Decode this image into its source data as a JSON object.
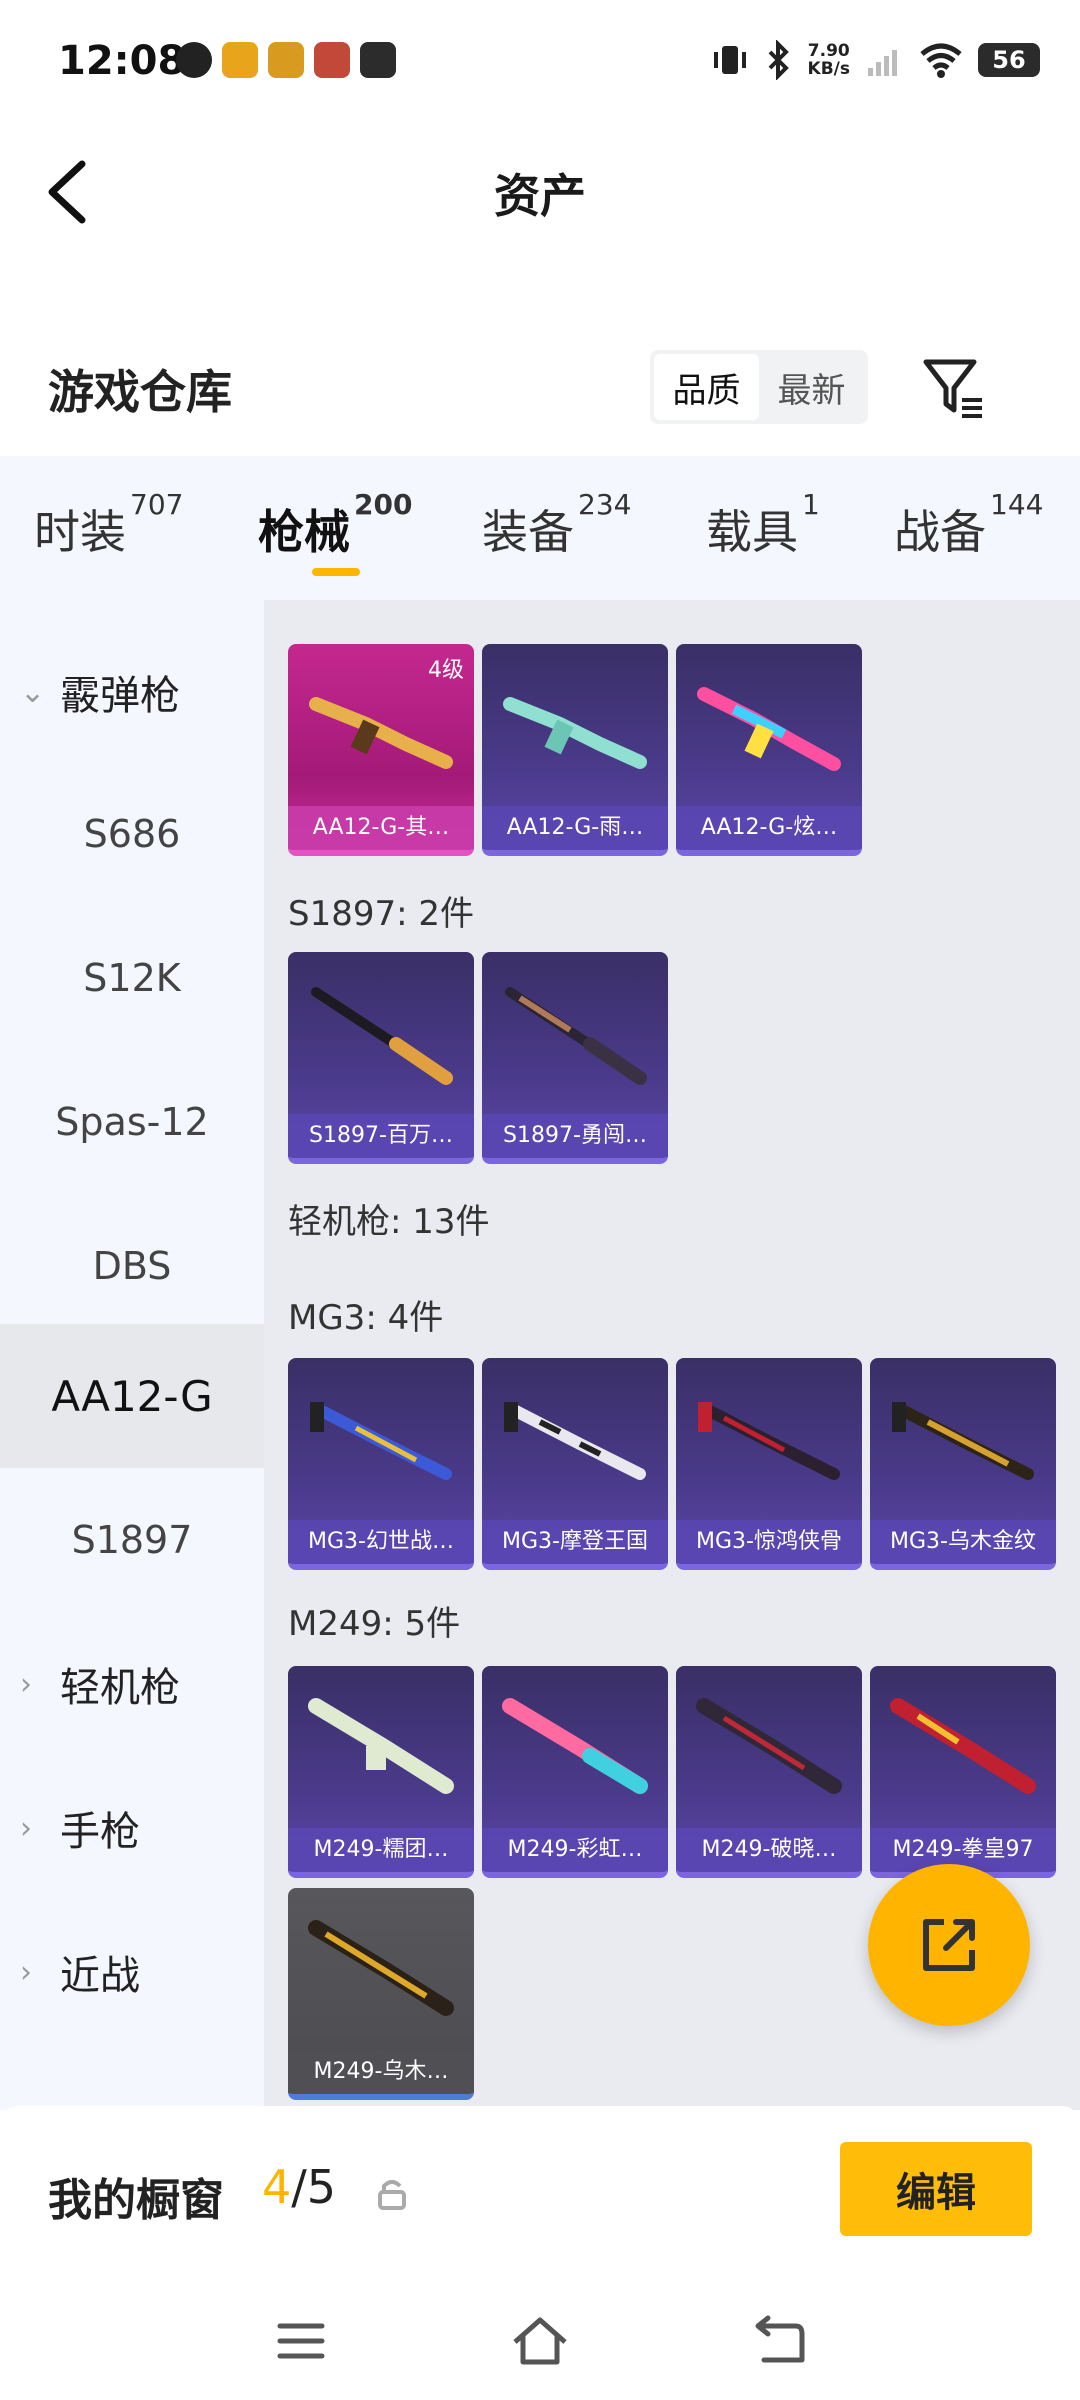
{
  "status": {
    "time": "12:08",
    "net_speed_value": "7.90",
    "net_speed_unit": "KB/s",
    "battery": "56"
  },
  "header": {
    "title": "资产"
  },
  "warehouse": {
    "title": "游戏仓库",
    "sort_options": [
      "品质",
      "最新"
    ]
  },
  "tabs": [
    {
      "label": "时装",
      "count": "707"
    },
    {
      "label": "枪械",
      "count": "200"
    },
    {
      "label": "装备",
      "count": "234"
    },
    {
      "label": "载具",
      "count": "1"
    },
    {
      "label": "战备",
      "count": "144"
    }
  ],
  "sidebar": {
    "items": [
      {
        "label": "霰弹枪"
      },
      {
        "label": "S686"
      },
      {
        "label": "S12K"
      },
      {
        "label": "Spas-12"
      },
      {
        "label": "DBS"
      },
      {
        "label": "AA12-G"
      },
      {
        "label": "S1897"
      },
      {
        "label": "轻机枪"
      },
      {
        "label": "手枪"
      },
      {
        "label": "近战"
      }
    ]
  },
  "content": {
    "sections": [
      {
        "title": "S1897: 2件"
      },
      {
        "title": "轻机枪: 13件"
      },
      {
        "title": "MG3: 4件"
      },
      {
        "title": "M249: 5件"
      }
    ],
    "aa12_cards": [
      {
        "label": "AA12-G-其…",
        "level": "4级"
      },
      {
        "label": "AA12-G-雨…"
      },
      {
        "label": "AA12-G-炫…"
      }
    ],
    "s1897_cards": [
      {
        "label": "S1897-百万…"
      },
      {
        "label": "S1897-勇闯…"
      }
    ],
    "mg3_cards": [
      {
        "label": "MG3-幻世战…"
      },
      {
        "label": "MG3-摩登王国"
      },
      {
        "label": "MG3-惊鸿侠骨"
      },
      {
        "label": "MG3-乌木金纹"
      }
    ],
    "m249_cards": [
      {
        "label": "M249-糯团…"
      },
      {
        "label": "M249-彩虹…"
      },
      {
        "label": "M249-破晓…"
      },
      {
        "label": "M249-拳皇97"
      },
      {
        "label": "M249-乌木…"
      }
    ]
  },
  "showcase": {
    "label": "我的橱窗",
    "current": "4",
    "total": "/5",
    "edit_label": "编辑"
  },
  "colors": {
    "accent": "#ffb400",
    "card_purple": "#4a3a8a",
    "card_pink": "#c4288f"
  }
}
